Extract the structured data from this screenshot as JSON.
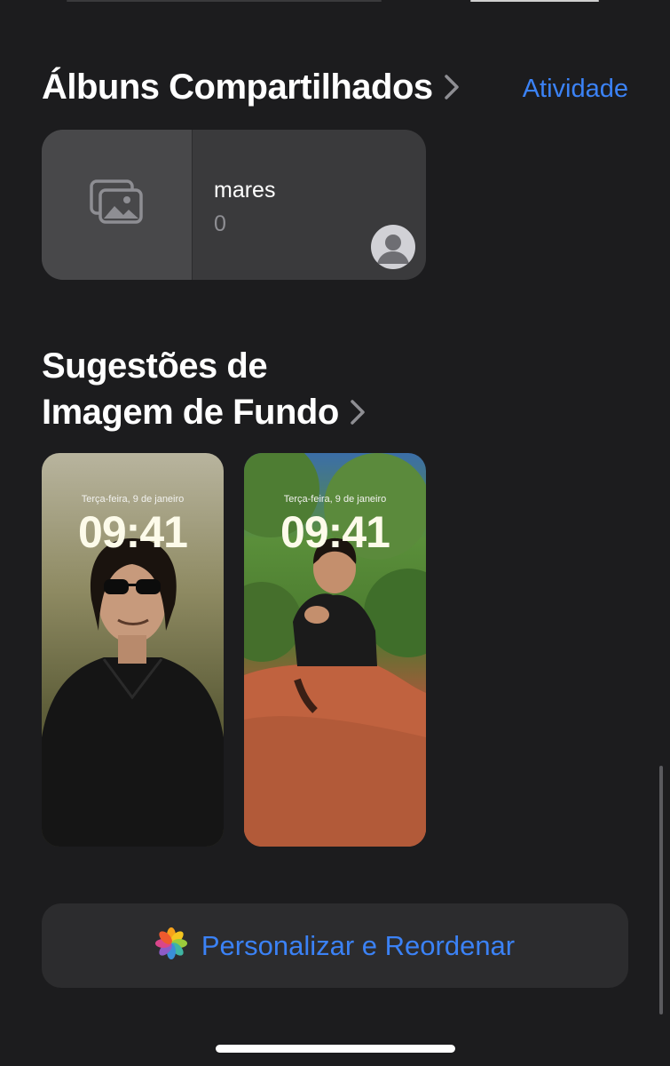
{
  "shared_albums": {
    "title": "Álbuns Compartilhados",
    "activity_link": "Atividade",
    "album": {
      "name": "mares",
      "count": "0"
    }
  },
  "wallpaper_suggestions": {
    "title_line1": "Sugestões de",
    "title_line2": "Imagem de Fundo",
    "items": [
      {
        "date": "Terça-feira, 9 de janeiro",
        "time": "09:41"
      },
      {
        "date": "Terça-feira, 9 de janeiro",
        "time": "09:41"
      }
    ]
  },
  "customize_button": {
    "label": "Personalizar e Reordenar",
    "icon": "photos-app-icon"
  },
  "colors": {
    "background": "#1c1c1e",
    "accent_blue": "#3b82f6",
    "card": "#3a3a3c"
  }
}
